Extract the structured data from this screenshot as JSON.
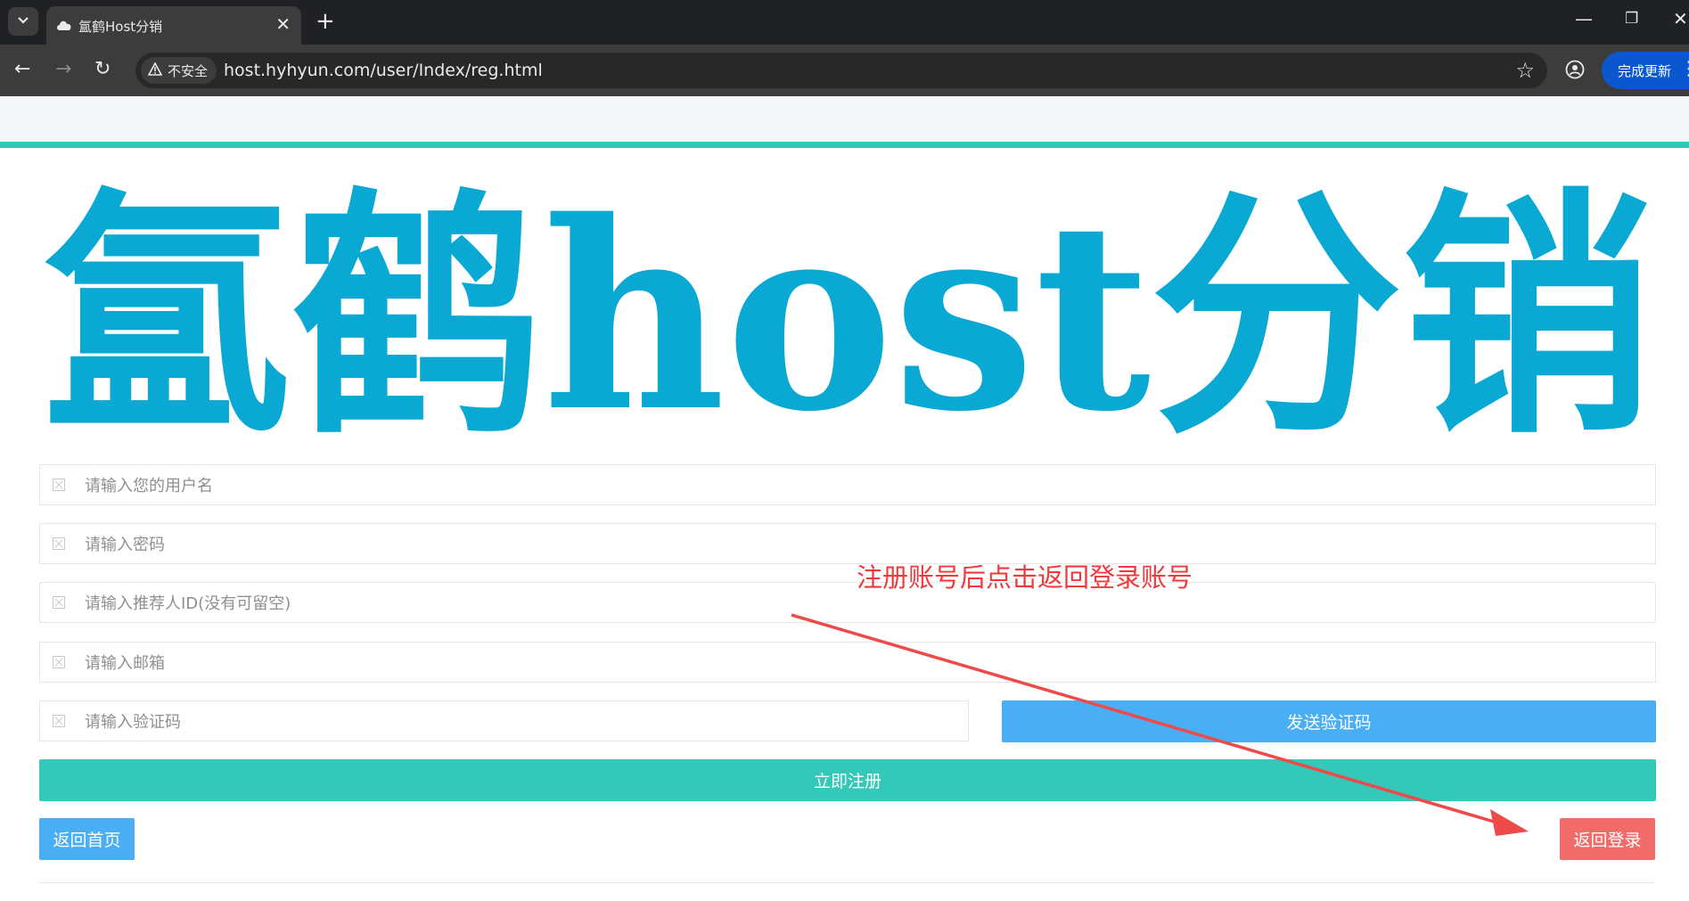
{
  "browser": {
    "tab_list_icon": "chevron-down-icon",
    "tab": {
      "title": "氲鹤Host分销",
      "favicon": "cloud-icon"
    },
    "new_tab_label": "+",
    "window_controls": {
      "minimize": "—",
      "restore": "❐",
      "close": "✕"
    },
    "nav": {
      "back": "←",
      "forward": "→",
      "reload": "↻"
    },
    "security_label": "不安全",
    "url": "host.hyhyun.com/user/Index/reg.html",
    "bookmark_icon": "☆",
    "update_button": "完成更新",
    "menu_icon": "⋮"
  },
  "page": {
    "logo_text": "氲鹤host分销",
    "logo_color": "#0aa9d4",
    "accent_color": "#2ec7b8",
    "form": {
      "username_placeholder": "请输入您的用户名",
      "password_placeholder": "请输入密码",
      "referrer_placeholder": "请输入推荐人ID(没有可留空)",
      "email_placeholder": "请输入邮箱",
      "code_placeholder": "请输入验证码",
      "send_code_label": "发送验证码",
      "register_label": "立即注册",
      "home_label": "返回首页",
      "login_label": "返回登录"
    },
    "annotation": "注册账号后点击返回登录账号",
    "colors": {
      "send_code": "#4aaef5",
      "register": "#33c8b8",
      "home": "#4aaef5",
      "login": "#f26b6b",
      "annotation": "#f0393a"
    }
  }
}
